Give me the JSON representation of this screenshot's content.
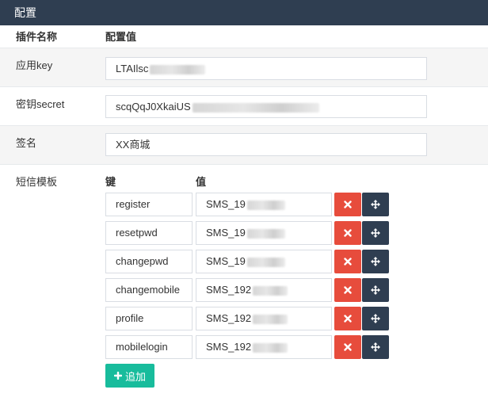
{
  "window": {
    "title": "配置"
  },
  "table": {
    "header": {
      "name_col": "插件名称",
      "value_col": "配置值"
    },
    "rows": {
      "app_key": {
        "label": "应用key",
        "value": "LTAIlsc"
      },
      "secret": {
        "label": "密钥secret",
        "value": "scqQqJ0XkaiUS"
      },
      "signature": {
        "label": "签名",
        "value": "XX商城"
      },
      "sms_template": {
        "label": "短信模板",
        "key_header": "键",
        "value_header": "值",
        "items": [
          {
            "key": "register",
            "value": "SMS_19"
          },
          {
            "key": "resetpwd",
            "value": "SMS_19"
          },
          {
            "key": "changepwd",
            "value": "SMS_19"
          },
          {
            "key": "changemobile",
            "value": "SMS_192"
          },
          {
            "key": "profile",
            "value": "SMS_192"
          },
          {
            "key": "mobilelogin",
            "value": "SMS_192"
          }
        ],
        "add_label": "追加"
      }
    }
  },
  "colors": {
    "title_bar": "#2f3e51",
    "delete": "#e74c3c",
    "move": "#2f3e51",
    "add": "#18bc9c"
  }
}
